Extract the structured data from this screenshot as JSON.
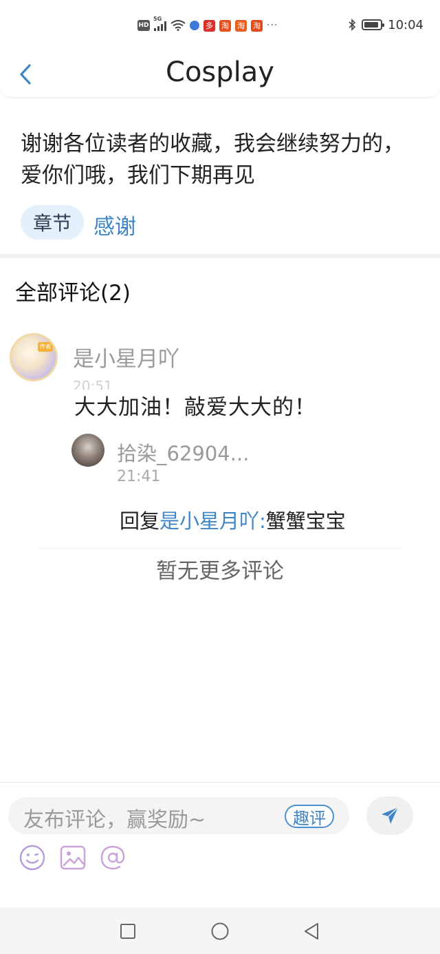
{
  "status_bar": {
    "network_badge": "HD",
    "network_type": "5G",
    "app_icons": [
      {
        "name": "pinduoduo-icon",
        "glyph": "多",
        "color": "#d9302c"
      },
      {
        "name": "taobao-icon",
        "glyph": "淘",
        "color": "#e8501f"
      },
      {
        "name": "taobao-live-icon",
        "glyph": "淘",
        "color": "#e8601f"
      },
      {
        "name": "taobao-icon-2",
        "glyph": "淘",
        "color": "#e24a1c"
      }
    ],
    "more_indicator": "···",
    "battery_level_percent": 90,
    "time": "10:04"
  },
  "header": {
    "title": "Cosplay"
  },
  "chapter": {
    "text": "谢谢各位读者的收藏，我会继续努力的，爱你们哦，我们下期再见",
    "tag_label": "章节",
    "tag_value": "感谢"
  },
  "comments": {
    "heading": "全部评论(2)",
    "items": [
      {
        "username": "是小星月吖",
        "time": "20:51",
        "text": "大大加油！敲爱大大的！",
        "avatar_badge": "作者",
        "reply": {
          "username": "拾染_62904...",
          "time": "21:41",
          "prefix": "回复",
          "mention": "是小星月吖:",
          "text": "蟹蟹宝宝"
        }
      }
    ],
    "no_more": "暂无更多评论"
  },
  "input": {
    "placeholder": "友布评论，赢奖励~",
    "quping_label": "趣评",
    "tools": [
      "emoji-icon",
      "image-icon",
      "mention-icon"
    ],
    "accent_color": "#3d85c6"
  },
  "nav": {
    "buttons": [
      "recent-apps",
      "home",
      "back"
    ]
  }
}
